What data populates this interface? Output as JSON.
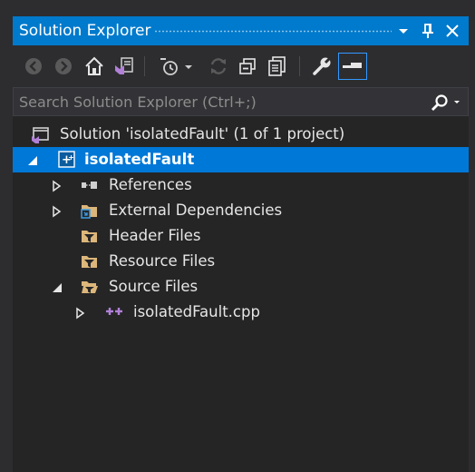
{
  "window": {
    "title": "Solution Explorer"
  },
  "toolbar": {
    "buttons": [
      "back-icon",
      "forward-icon",
      "home-icon",
      "switch-views-icon",
      "pending-changes-filter-icon",
      "sync-icon",
      "collapse-all-icon",
      "show-all-files-icon",
      "properties-icon",
      "preview-selected-icon"
    ]
  },
  "search": {
    "placeholder": "Search Solution Explorer (Ctrl+;)",
    "value": ""
  },
  "tree": {
    "solution": "Solution 'isolatedFault' (1 of 1 project)",
    "project": "isolatedFault",
    "items": [
      {
        "label": "References"
      },
      {
        "label": "External Dependencies"
      },
      {
        "label": "Header Files"
      },
      {
        "label": "Resource Files"
      },
      {
        "label": "Source Files"
      },
      {
        "label": "isolatedFault.cpp"
      }
    ]
  },
  "colors": {
    "accent": "#007acc",
    "selection": "#0078d7",
    "background": "#252526"
  }
}
